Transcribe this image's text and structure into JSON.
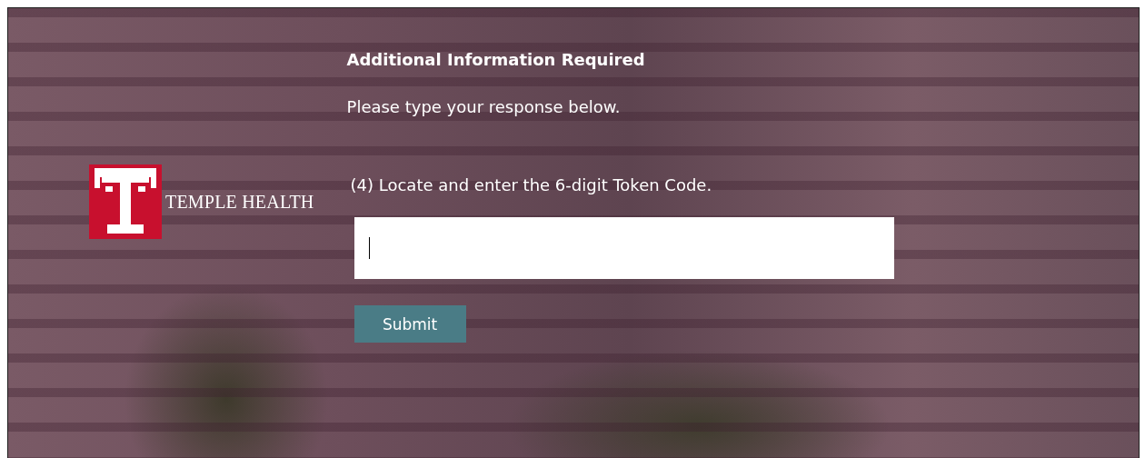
{
  "brand": {
    "name": "TEMPLE HEALTH"
  },
  "form": {
    "title": "Additional Information Required",
    "subtitle": "Please type your response below.",
    "prompt": "(4) Locate and enter the 6-digit Token Code.",
    "field": {
      "focused": true
    },
    "button": "Submit"
  }
}
